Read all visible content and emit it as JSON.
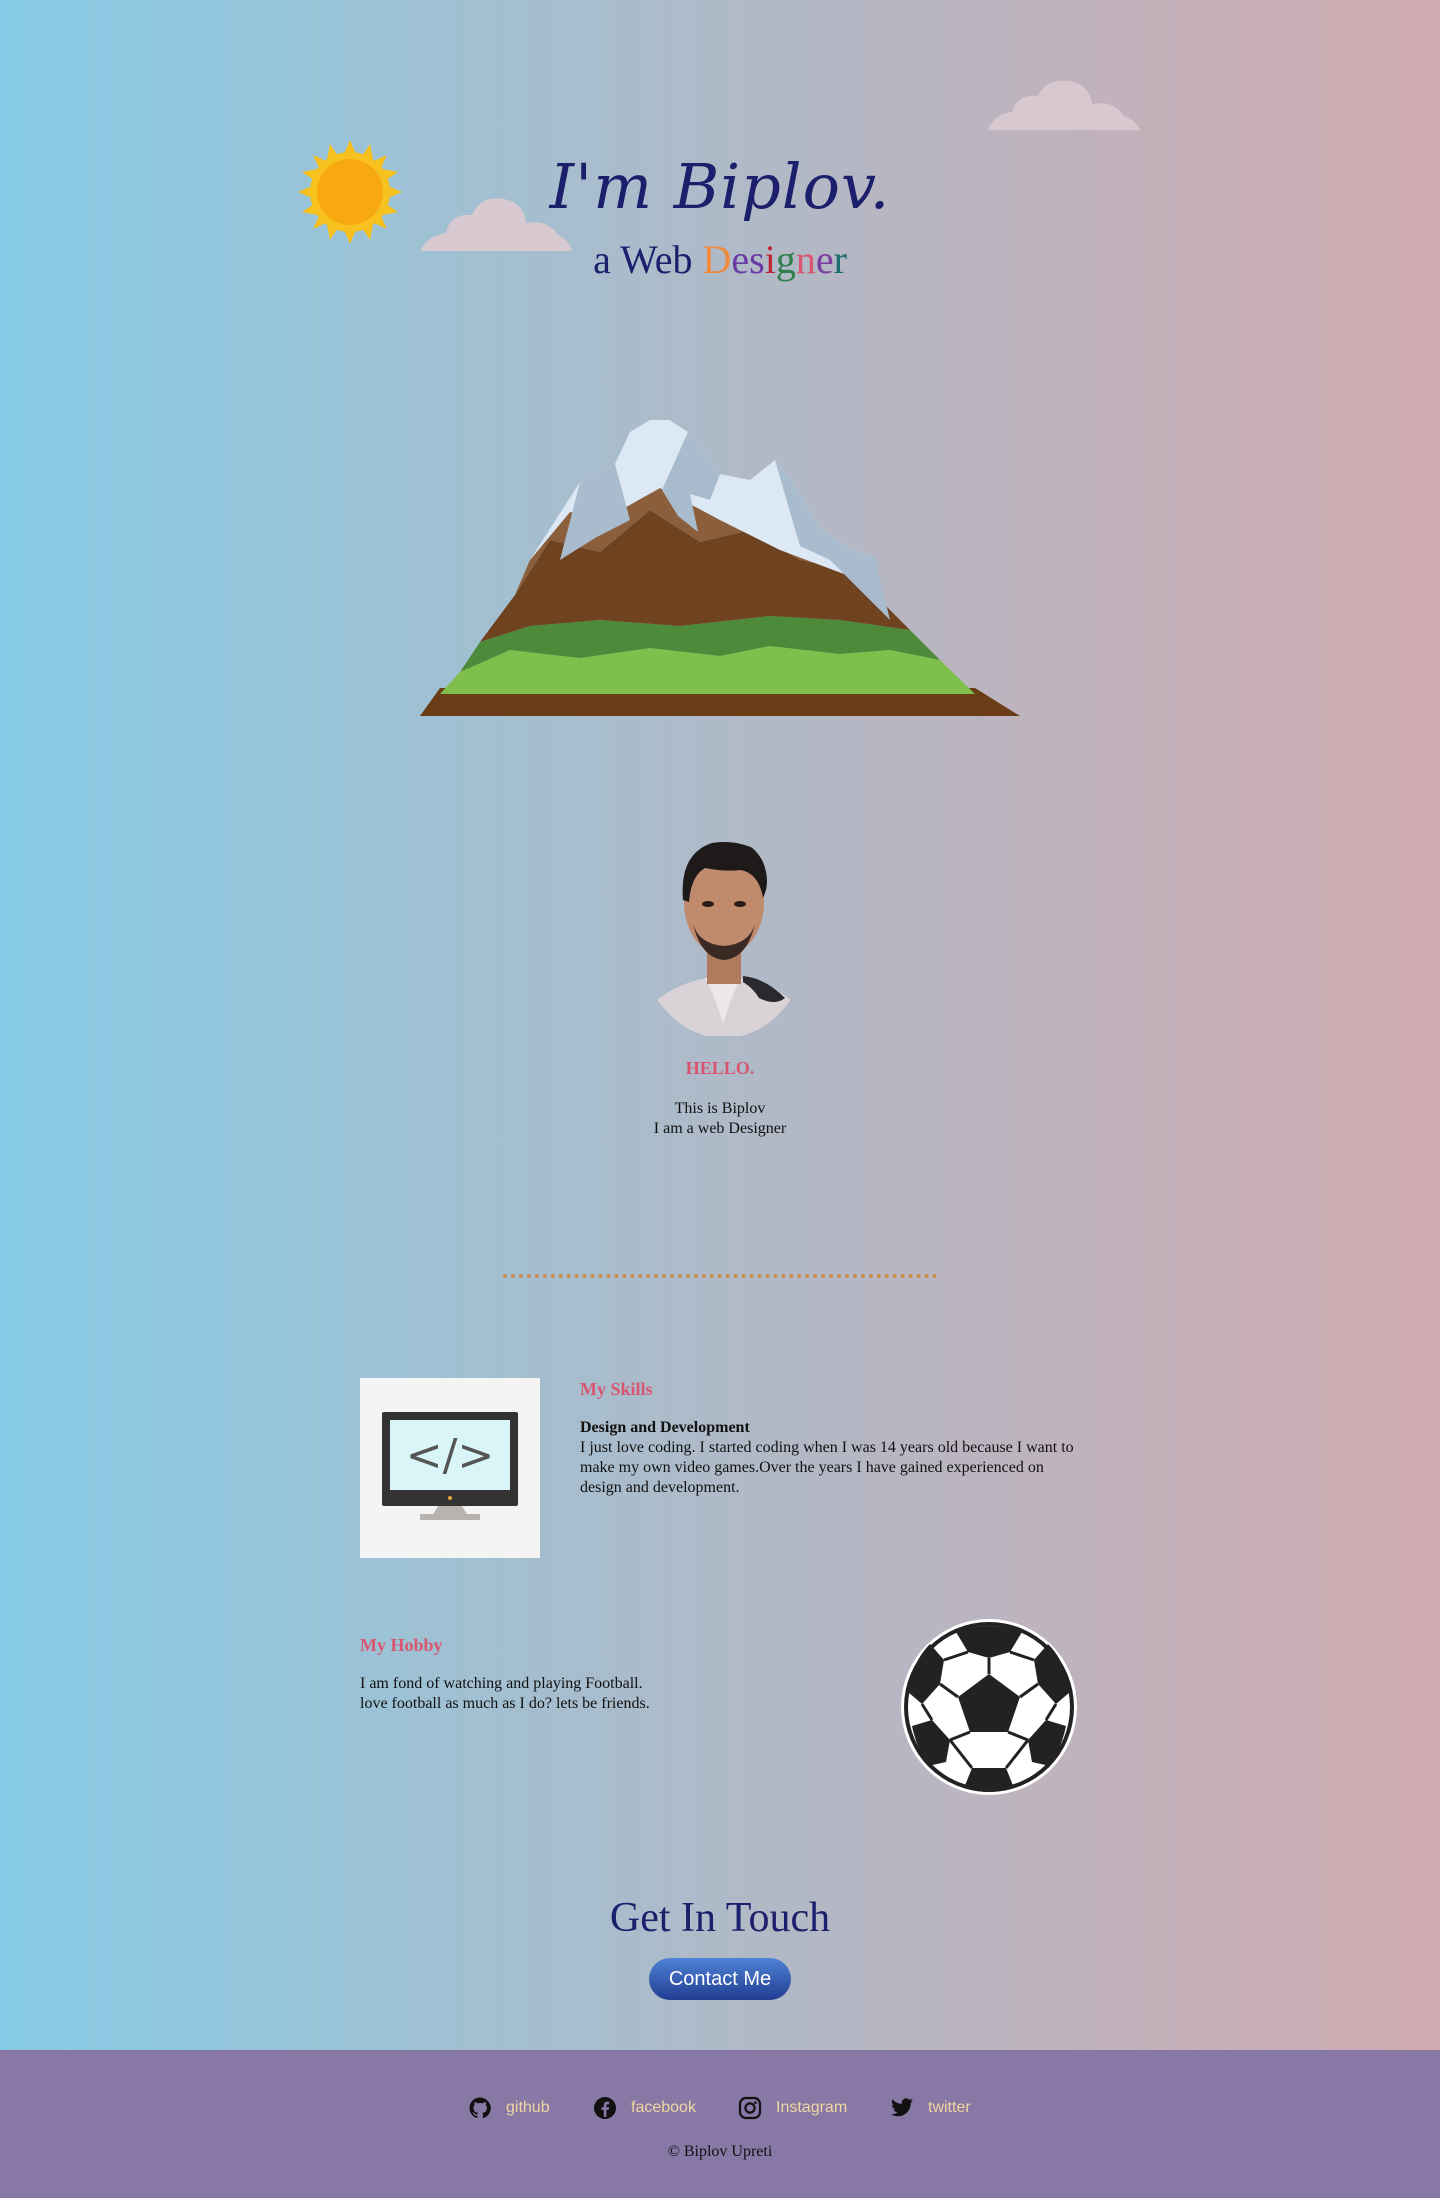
{
  "hero": {
    "title": "I'm Biplov.",
    "subtitle_words": [
      "a",
      "Web"
    ],
    "subtitle_designer_letters": [
      "D",
      "e",
      "s",
      "i",
      "g",
      "n",
      "e",
      "r"
    ],
    "designer_letter_colors": [
      "#f08a3c",
      "#6a3aa5",
      "#6a3aa5",
      "#c0243b",
      "#2f7f4f",
      "#d8566f",
      "#7a3fa0",
      "#1c6b70"
    ]
  },
  "about": {
    "hello": "HELLO.",
    "line1": "This is Biplov",
    "line2": "I am a web Designer"
  },
  "skills": {
    "heading": "My Skills",
    "subheading": "Design and Development",
    "body": "I just love coding. I started coding when I was 14 years old because I want to make my own video games.Over the years I have gained experienced on design and development.",
    "icon": "code-monitor-icon"
  },
  "hobby": {
    "heading": "My Hobby",
    "line1": "I am fond of watching and playing Football.",
    "line2": "love football as much as I do? lets be friends.",
    "icon": "football-icon"
  },
  "contact": {
    "title": "Get In Touch",
    "button_label": "Contact Me"
  },
  "footer": {
    "links": [
      {
        "label": "github",
        "icon": "github-icon"
      },
      {
        "label": "facebook",
        "icon": "facebook-icon"
      },
      {
        "label": "Instagram",
        "icon": "instagram-icon"
      },
      {
        "label": "twitter",
        "icon": "twitter-icon"
      }
    ],
    "copyright": "© Biplov Upreti"
  },
  "colors": {
    "accent_pink": "#d8566f",
    "navy": "#1c1f6b",
    "footer_bg": "#8878a5",
    "link_text": "#f0d7a0",
    "divider": "#c98b4a"
  }
}
